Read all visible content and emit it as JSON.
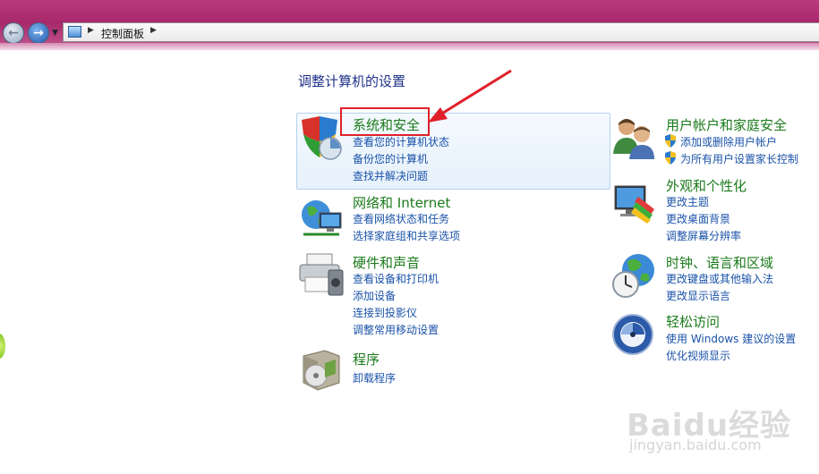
{
  "addressbar": {
    "location": "控制面板"
  },
  "page_title": "调整计算机的设置",
  "categories": {
    "system_security": {
      "title": "系统和安全",
      "links": [
        "查看您的计算机状态",
        "备份您的计算机",
        "查找并解决问题"
      ]
    },
    "network": {
      "title": "网络和 Internet",
      "links": [
        "查看网络状态和任务",
        "选择家庭组和共享选项"
      ]
    },
    "hardware": {
      "title": "硬件和声音",
      "links": [
        "查看设备和打印机",
        "添加设备",
        "连接到投影仪",
        "调整常用移动设置"
      ]
    },
    "programs": {
      "title": "程序",
      "links": [
        "卸载程序"
      ]
    },
    "user_accounts": {
      "title": "用户帐户和家庭安全",
      "links": [
        "添加或删除用户帐户",
        "为所有用户设置家长控制"
      ]
    },
    "appearance": {
      "title": "外观和个性化",
      "links": [
        "更改主题",
        "更改桌面背景",
        "调整屏幕分辨率"
      ]
    },
    "clock_region": {
      "title": "时钟、语言和区域",
      "links": [
        "更改键盘或其他输入法",
        "更改显示语言"
      ]
    },
    "ease_access": {
      "title": "轻松访问",
      "links": [
        "使用 Windows 建议的设置",
        "优化视频显示"
      ]
    }
  },
  "icons": {
    "system_security": "shield-security-icon",
    "network": "network-globe-icon",
    "hardware": "printer-icon",
    "programs": "programs-box-icon",
    "user_accounts": "users-icon",
    "appearance": "monitor-paint-icon",
    "clock_region": "globe-clock-icon",
    "ease_access": "ease-of-access-icon"
  },
  "colors": {
    "accent_link": "#1a52a8",
    "category_title": "#1b7a1b",
    "annotation": "#e0202a",
    "titlebar": "#a8286b"
  },
  "watermark": {
    "logo": "Baidu经验",
    "sub": "jingyan.baidu.com"
  }
}
